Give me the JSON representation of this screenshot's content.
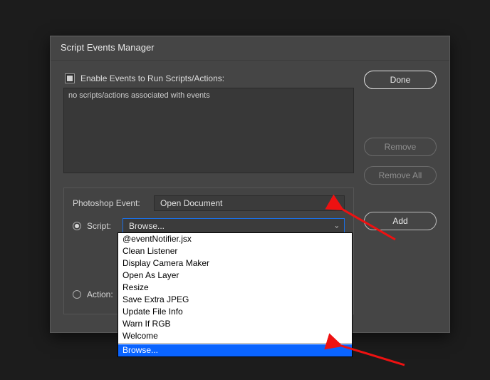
{
  "dialog": {
    "title": "Script Events Manager",
    "enable_label": "Enable Events to Run Scripts/Actions:",
    "list_placeholder": "no scripts/actions associated with events",
    "event_label": "Photoshop Event:",
    "event_value": "Open Document",
    "script_label": "Script:",
    "script_value": "Browse...",
    "action_label": "Action:",
    "buttons": {
      "done": "Done",
      "remove": "Remove",
      "remove_all": "Remove All",
      "add": "Add"
    }
  },
  "dropdown": {
    "items": [
      "@eventNotifier.jsx",
      "Clean Listener",
      "Display Camera Maker",
      "Open As Layer",
      "Resize",
      "Save Extra JPEG",
      "Update File Info",
      "Warn If RGB",
      "Welcome"
    ],
    "selected": "Browse..."
  }
}
